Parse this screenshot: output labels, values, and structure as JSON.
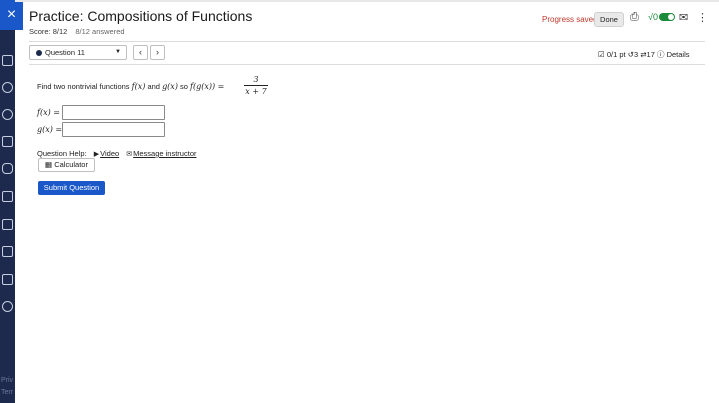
{
  "window": {
    "close_icon": "×"
  },
  "sidebar": {
    "icons": [
      "institution-icon",
      "person-icon",
      "globe-icon",
      "gradebook-icon",
      "people-icon",
      "calendar-icon",
      "mail-icon",
      "document-icon",
      "edit-icon",
      "logout-icon"
    ],
    "footer_lines": [
      "Priv",
      "Terr"
    ]
  },
  "header": {
    "title": "Practice: Compositions of Functions",
    "score": "Score: 8/12",
    "answered": "8/12 answered",
    "progress_status": "Progress saved",
    "done_label": "Done",
    "print_icon": "⎙",
    "sqrt_label": "√0",
    "mail_icon": "✉",
    "more_icon": "⋮"
  },
  "question_nav": {
    "selected": "Question 11",
    "prev_icon": "‹",
    "next_icon": "›",
    "points": "0/1 pt",
    "retries_icon": "↺",
    "retries": "3",
    "attempts_icon": "⇄",
    "attempts": "17",
    "details_icon": "ⓘ",
    "details": "Details"
  },
  "question": {
    "prompt_text": "Find two nontrivial functions",
    "f_notation": "f(x)",
    "and_text": "and",
    "g_notation": "g(x)",
    "so_text": "so",
    "composition": "f(g(x)) =",
    "numerator": "3",
    "denominator": "x + 7",
    "f_label": "f(x) =",
    "g_label": "g(x) =",
    "f_value": "",
    "g_value": ""
  },
  "help": {
    "label": "Question Help:",
    "video_icon": "▶",
    "video": "Video",
    "message_icon": "✉",
    "message": "Message instructor",
    "calculator_icon": "▦",
    "calculator": "Calculator"
  },
  "submit_label": "Submit Question",
  "colors": {
    "accent": "#1a57c8",
    "sidebar": "#1d2a4d",
    "saved": "#c0392b",
    "toggle": "#1b8a3a"
  }
}
